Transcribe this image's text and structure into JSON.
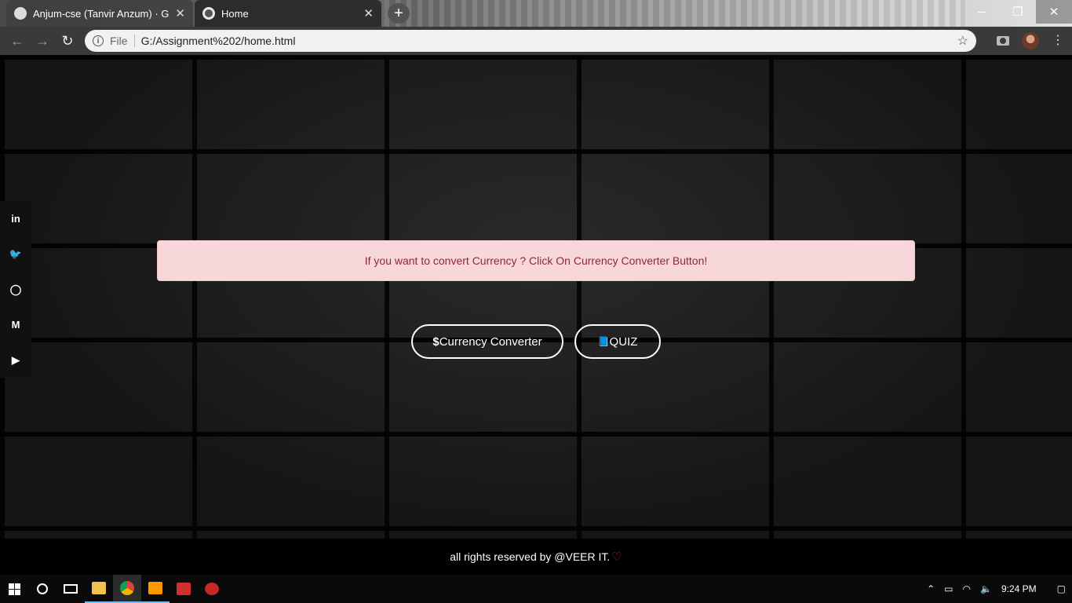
{
  "browser": {
    "tabs": [
      {
        "title": "Anjum-cse (Tanvir Anzum) · GitHub",
        "close": "✕"
      },
      {
        "title": "Home",
        "close": "✕"
      }
    ],
    "new_tab": "+",
    "window_controls": {
      "minimize": "─",
      "restore": "❐",
      "close": "✕"
    },
    "address_bar": {
      "scheme_label": "File",
      "url": "G:/Assignment%202/home.html"
    }
  },
  "page": {
    "social_links": [
      {
        "label": "in",
        "icon": "linkedin-icon"
      },
      {
        "label": "🐦",
        "icon": "twitter-icon"
      },
      {
        "label": "◯",
        "icon": "github-icon"
      },
      {
        "label": "M",
        "icon": "medium-icon"
      },
      {
        "label": "▶",
        "icon": "youtube-icon"
      }
    ],
    "alert_text": "If you want to convert Currency ? Click On Currency Converter Button!",
    "buttons": {
      "currency_symbol": "$",
      "currency_label": "Currency Converter",
      "quiz_symbol": "📘",
      "quiz_label": "QUIZ"
    },
    "footer_text": "all rights reserved by @VEER IT.",
    "footer_heart": "♡"
  },
  "taskbar": {
    "clock": "9:24 PM"
  },
  "colors": {
    "alert_bg": "#f8d7da",
    "alert_text": "#8a2a36",
    "heart": "#e02020"
  }
}
